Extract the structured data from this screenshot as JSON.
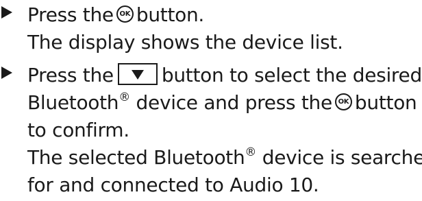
{
  "steps": [
    {
      "before": "Press the",
      "icon": "ok-button-icon",
      "icon_text": "OK",
      "after": "button.",
      "result": "The display shows the device list."
    },
    {
      "before": "Press the",
      "icon": "down-arrow-key-icon",
      "after": "button to select the desired",
      "line2_a": "Bluetooth",
      "reg": "®",
      "line2_b": "device and press the",
      "icon2": "ok-button-icon",
      "icon2_text": "OK",
      "line2_c": "button",
      "line3": "to confirm.",
      "result_a": "The selected Bluetooth",
      "result_reg": "®",
      "result_b": "device is searched",
      "result_line2": "for and connected to Audio 10."
    }
  ]
}
